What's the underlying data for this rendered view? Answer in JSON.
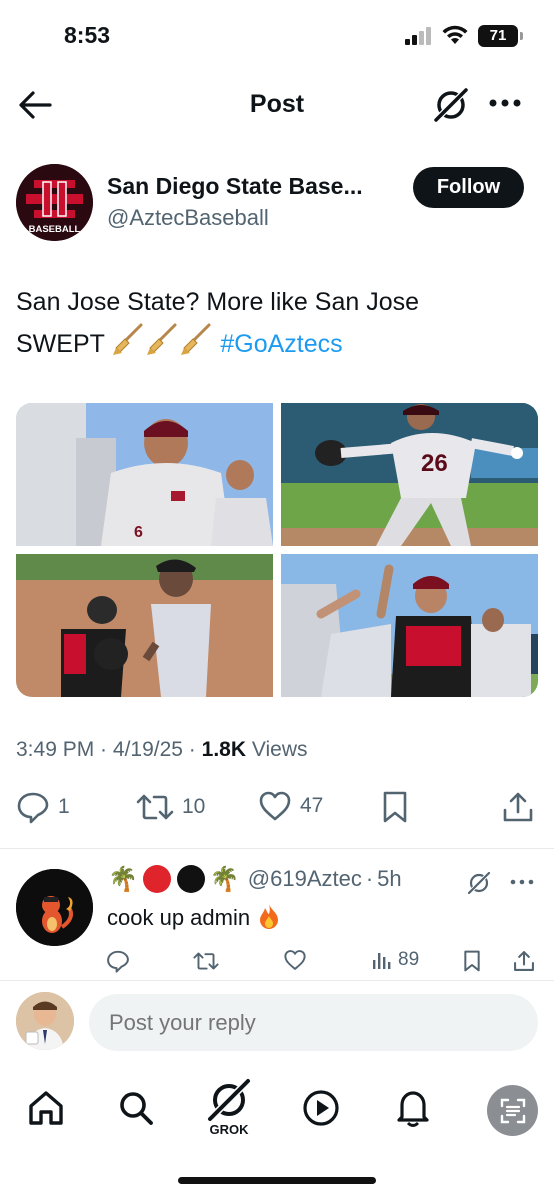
{
  "status_bar": {
    "time": "8:53",
    "battery": "71"
  },
  "header": {
    "title": "Post"
  },
  "post": {
    "author_name": "San Diego State Base...",
    "author_handle": "@AztecBaseball",
    "avatar_text": "BASEBALL",
    "follow_label": "Follow",
    "text_line1": "San Jose State? More like San Jose",
    "text_line2": "SWEPT",
    "hashtag": "#GoAztecs",
    "jersey_number_1": "6",
    "jersey_number_2": "26",
    "time": "3:49 PM",
    "date": "4/19/25",
    "views_count": "1.8K",
    "views_label": "Views",
    "replies": "1",
    "reposts": "10",
    "likes": "47"
  },
  "reply": {
    "handle": "@619Aztec",
    "age": "5h",
    "text": "cook up admin",
    "views": "89"
  },
  "compose": {
    "placeholder": "Post your reply"
  },
  "tabbar": {
    "grok_label": "GROK"
  },
  "colors": {
    "accent": "#1d9bf0",
    "text": "#0f1419",
    "muted": "#536471",
    "aztec_red": "#a6192e"
  },
  "icons": [
    "back-arrow-icon",
    "grok-icon",
    "more-icon",
    "broom-icon",
    "reply-icon",
    "repost-icon",
    "like-icon",
    "bookmark-icon",
    "share-icon",
    "views-icon",
    "home-icon",
    "search-icon",
    "play-icon",
    "bell-icon",
    "scan-icon"
  ]
}
